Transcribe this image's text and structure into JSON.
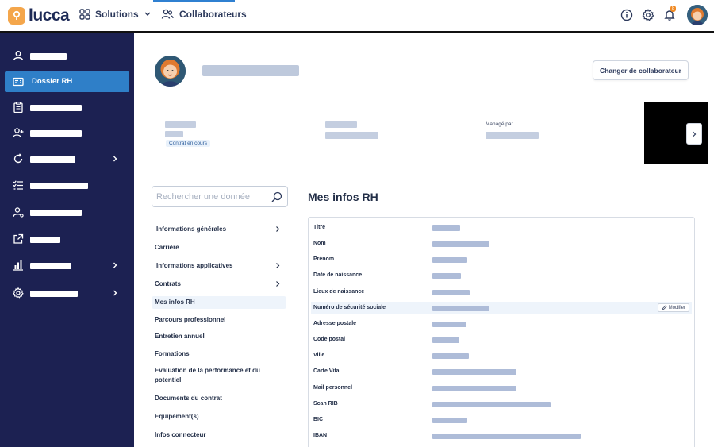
{
  "topbar": {
    "logo_text": "lucca",
    "solutions_label": "Solutions",
    "collaborateurs_label": "Collaborateurs",
    "notification_count": "8",
    "icons": [
      "info-icon",
      "gear-icon",
      "bell-icon"
    ]
  },
  "sidebar": {
    "active_label": "Dossier RH",
    "items": [
      {
        "icon": "user-icon",
        "has_chevron": false
      },
      {
        "icon": "id-card-icon",
        "active": true
      },
      {
        "icon": "clipboard-icon",
        "has_chevron": false
      },
      {
        "icon": "user-plus-icon",
        "has_chevron": false
      },
      {
        "icon": "refresh-icon",
        "has_chevron": true
      },
      {
        "icon": "checklist-icon",
        "has_chevron": false
      },
      {
        "icon": "user-gear-icon",
        "has_chevron": false
      },
      {
        "icon": "external-link-icon",
        "has_chevron": false
      },
      {
        "icon": "chart-icon",
        "has_chevron": true
      },
      {
        "icon": "settings-icon",
        "has_chevron": true
      }
    ]
  },
  "header": {
    "change_button": "Changer de collaborateur",
    "contrat_badge": "Contrat en cours",
    "manage_label": "Managé par"
  },
  "search": {
    "placeholder": "Rechercher une donnée"
  },
  "left_menu": [
    {
      "label": "Informations générales",
      "chevron": true
    },
    {
      "label": "Carrière",
      "chevron": false
    },
    {
      "label": "Informations applicatives",
      "chevron": true
    },
    {
      "label": "Contrats",
      "chevron": true
    },
    {
      "label": "Mes infos RH",
      "chevron": false,
      "active": true
    },
    {
      "label": "Parcours professionnel",
      "chevron": false
    },
    {
      "label": "Entretien annuel",
      "chevron": false
    },
    {
      "label": "Formations",
      "chevron": false
    },
    {
      "label": "Evaluation de la performance et du potentiel",
      "chevron": false
    },
    {
      "label": "Documents du contrat",
      "chevron": false
    },
    {
      "label": "Equipement(s)",
      "chevron": false
    },
    {
      "label": "Infos connecteur",
      "chevron": false
    }
  ],
  "main": {
    "title": "Mes infos RH",
    "modify_label": "Modifier",
    "fields": [
      "Titre",
      "Nom",
      "Prénom",
      "Date de naissance",
      "Lieux de naissance",
      "Numéro de sécurité sociale",
      "Adresse postale",
      "Code postal",
      "Ville",
      "Carte Vital",
      "Mail personnel",
      "Scan RIB",
      "BIC",
      "IBAN"
    ]
  }
}
